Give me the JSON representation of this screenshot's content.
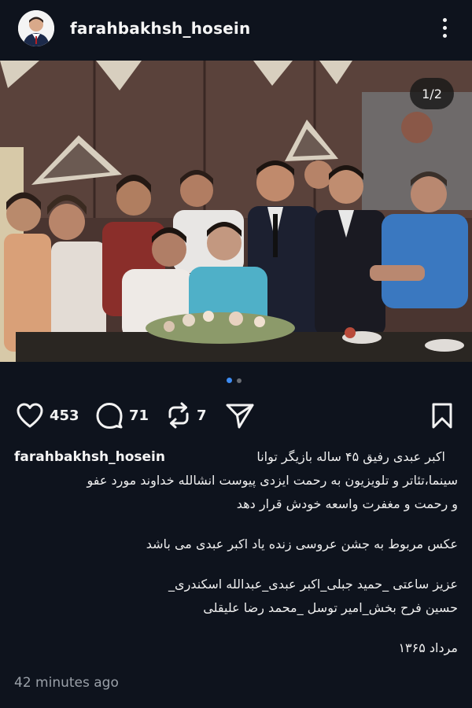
{
  "header": {
    "username": "farahbakhsh_hosein",
    "avatar_icon": "profile-avatar",
    "more_icon": "more-vertical-icon"
  },
  "post": {
    "counter": "1/2",
    "current_slide": 1,
    "total_slides": 2,
    "photo_description_icon": "vintage-group-photo",
    "accent_color": "#3d8cf2"
  },
  "actions": {
    "like_count": "453",
    "comment_count": "71",
    "repost_count": "7",
    "like_icon": "heart-icon",
    "comment_icon": "comment-icon",
    "repost_icon": "repost-icon",
    "share_icon": "send-icon",
    "save_icon": "bookmark-icon"
  },
  "caption": {
    "username": "farahbakhsh_hosein",
    "line1": "اکبر عبدی رفیق ۴۵ ساله بازیگر توانا",
    "line2": "سینما،تئاتر و تلویزیون به رحمت ایزدی پیوست انشالله خداوند مورد عفو",
    "line3": "و رحمت و مغفرت واسعه خودش قرار دهد",
    "line4": "عکس مربوط به جشن عروسی زنده یاد اکبر عبدی می باشد",
    "line5": "عزیز ساعتی _حمید جبلی_اکبر عبدی_عبدالله اسکندری_",
    "line6": "حسین فرح بخش_امیر توسل _محمد رضا علیقلی",
    "line7": "مرداد ۱۳۶۵"
  },
  "timestamp": "42 minutes ago"
}
